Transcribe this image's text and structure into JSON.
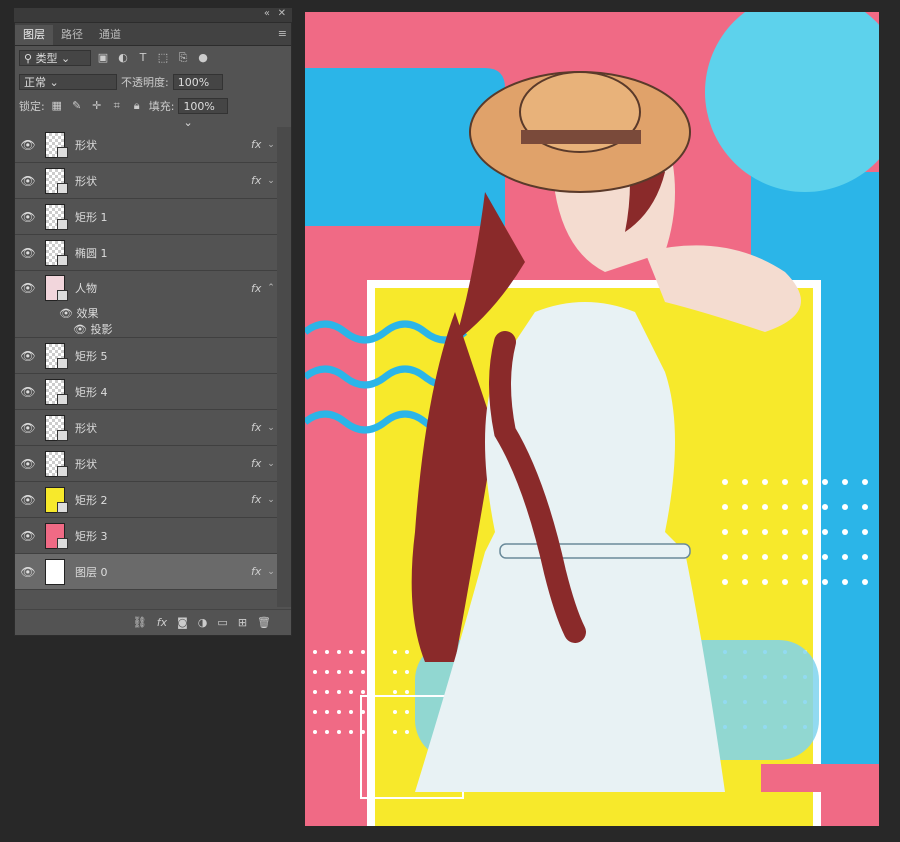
{
  "panel_tabs": [
    "图层",
    "路径",
    "通道"
  ],
  "filter_label": "类型",
  "blend_mode": "正常",
  "opacity_label": "不透明度:",
  "opacity_value": "100%",
  "lock_label": "锁定:",
  "fill_label": "填充:",
  "fill_value": "100%",
  "layers": [
    {
      "name": "形状",
      "fx": "fx"
    },
    {
      "name": "形状",
      "fx": "fx"
    },
    {
      "name": "矩形 1",
      "fx": ""
    },
    {
      "name": "椭圆 1",
      "fx": ""
    },
    {
      "name": "人物",
      "fx": "fx"
    },
    {
      "name": "矩形 5",
      "fx": ""
    },
    {
      "name": "矩形 4",
      "fx": ""
    },
    {
      "name": "形状",
      "fx": "fx"
    },
    {
      "name": "形状",
      "fx": "fx"
    },
    {
      "name": "矩形 2",
      "fx": "fx"
    },
    {
      "name": "矩形 3",
      "fx": ""
    },
    {
      "name": "图层 0",
      "fx": "fx"
    }
  ],
  "effects_label": "效果",
  "drop_shadow_label": "投影",
  "colors": {
    "pink": "#f06a85",
    "blue": "#2bb5e8",
    "yellow": "#f7e92b",
    "light_blue": "#7fd3ef"
  }
}
